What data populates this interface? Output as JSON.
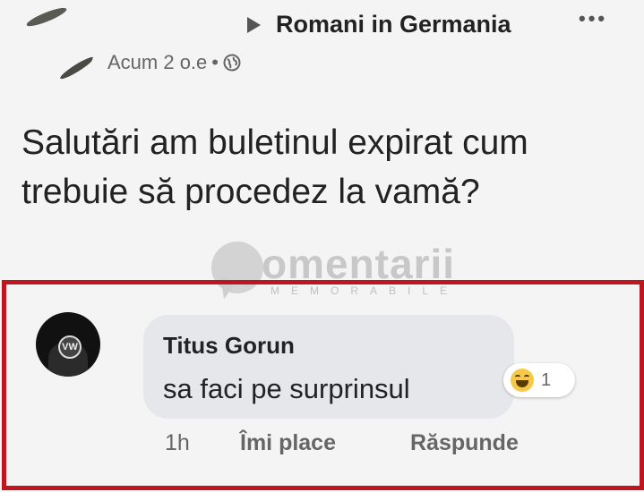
{
  "post": {
    "group_name": "Romani in Germania",
    "time": "Acum 2 o.e",
    "separator": "•",
    "text": "Salutări am buletinul expirat cum trebuie să procedez la vamă?"
  },
  "watermark": {
    "text": "omentarii",
    "subtext": "MEMORABILE"
  },
  "comment": {
    "author": "Titus Gorun",
    "text": "sa faci pe surprinsul",
    "reaction_icon": "haha-emoji",
    "reaction_count": "1",
    "time": "1h",
    "like_label": "Îmi place",
    "reply_label": "Răspunde"
  },
  "colors": {
    "frame": "#c0141f",
    "bubble": "#e6e7eb"
  }
}
